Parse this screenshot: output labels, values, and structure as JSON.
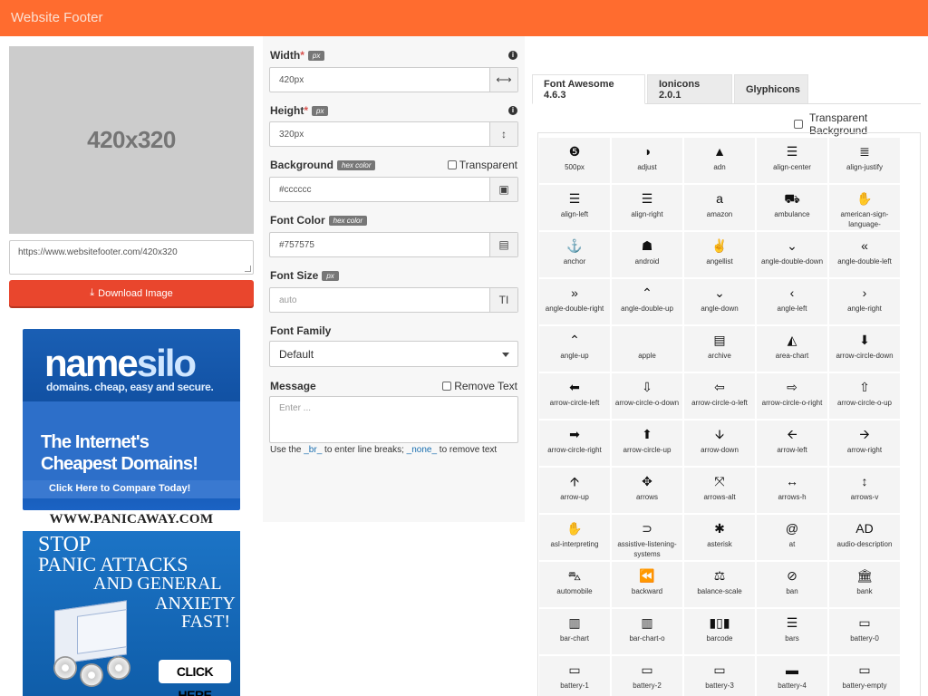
{
  "header": {
    "title": "Website Footer"
  },
  "preview": {
    "text": "420x320",
    "url": "https://www.websitefooter.com/420x320",
    "download_label": "Download Image"
  },
  "form": {
    "width": {
      "label": "Width",
      "unit": "px",
      "value": "420px"
    },
    "height": {
      "label": "Height",
      "unit": "px",
      "value": "320px"
    },
    "background": {
      "label": "Background",
      "unit": "hex color",
      "value": "#cccccc",
      "transparent_label": "Transparent"
    },
    "font_color": {
      "label": "Font Color",
      "unit": "hex color",
      "value": "#757575"
    },
    "font_size": {
      "label": "Font Size",
      "unit": "px",
      "placeholder": "auto"
    },
    "font_family": {
      "label": "Font Family",
      "selected": "Default"
    },
    "message": {
      "label": "Message",
      "remove_label": "Remove Text",
      "placeholder": "Enter ..."
    },
    "hint": {
      "pre": "Use the ",
      "br": "_br_",
      "mid": " to enter line breaks; ",
      "none": "_none_",
      "post": " to remove text"
    }
  },
  "ads": {
    "namesilo": {
      "logo_a": "name",
      "logo_b": "silo",
      "tagline": "domains. cheap, easy and secure.",
      "headline1": "The Internet's",
      "headline2": "Cheapest Domains!",
      "cta": "Click Here to Compare Today!"
    },
    "panic": {
      "url": "WWW.PANICAWAY.COM",
      "line1": "STOP",
      "line2": "PANIC ATTACKS",
      "line3": "AND GENERAL",
      "line4": "ANXIETY",
      "line5": "FAST!",
      "cta": "CLICK HERE"
    }
  },
  "tabs": [
    "Font Awesome 4.6.3",
    "Ionicons 2.0.1",
    "Glyphicons"
  ],
  "transparent_background_label": "Transparent Background",
  "icons": [
    {
      "g": "❺",
      "n": "500px"
    },
    {
      "g": "◑",
      "n": "adjust"
    },
    {
      "g": "▲",
      "n": "adn"
    },
    {
      "g": "☰",
      "n": "align-center"
    },
    {
      "g": "≣",
      "n": "align-justify"
    },
    {
      "g": "☰",
      "n": "align-left"
    },
    {
      "g": "☰",
      "n": "align-right"
    },
    {
      "g": "a",
      "n": "amazon"
    },
    {
      "g": "⛟",
      "n": "ambulance"
    },
    {
      "g": "✋",
      "n": "american-sign-language-interpreting"
    },
    {
      "g": "⚓",
      "n": "anchor"
    },
    {
      "g": "☗",
      "n": "android"
    },
    {
      "g": "✌",
      "n": "angellist"
    },
    {
      "g": "⌄",
      "n": "angle-double-down"
    },
    {
      "g": "«",
      "n": "angle-double-left"
    },
    {
      "g": "»",
      "n": "angle-double-right"
    },
    {
      "g": "⌃",
      "n": "angle-double-up"
    },
    {
      "g": "⌄",
      "n": "angle-down"
    },
    {
      "g": "‹",
      "n": "angle-left"
    },
    {
      "g": "›",
      "n": "angle-right"
    },
    {
      "g": "⌃",
      "n": "angle-up"
    },
    {
      "g": "",
      "n": "apple"
    },
    {
      "g": "▤",
      "n": "archive"
    },
    {
      "g": "◭",
      "n": "area-chart"
    },
    {
      "g": "⬇",
      "n": "arrow-circle-down"
    },
    {
      "g": "⬅",
      "n": "arrow-circle-left"
    },
    {
      "g": "⇩",
      "n": "arrow-circle-o-down"
    },
    {
      "g": "⇦",
      "n": "arrow-circle-o-left"
    },
    {
      "g": "⇨",
      "n": "arrow-circle-o-right"
    },
    {
      "g": "⇧",
      "n": "arrow-circle-o-up"
    },
    {
      "g": "➡",
      "n": "arrow-circle-right"
    },
    {
      "g": "⬆",
      "n": "arrow-circle-up"
    },
    {
      "g": "🡫",
      "n": "arrow-down"
    },
    {
      "g": "🡨",
      "n": "arrow-left"
    },
    {
      "g": "🡪",
      "n": "arrow-right"
    },
    {
      "g": "🡩",
      "n": "arrow-up"
    },
    {
      "g": "✥",
      "n": "arrows"
    },
    {
      "g": "⤧",
      "n": "arrows-alt"
    },
    {
      "g": "↔",
      "n": "arrows-h"
    },
    {
      "g": "↕",
      "n": "arrows-v"
    },
    {
      "g": "✋",
      "n": "asl-interpreting"
    },
    {
      "g": "⊃",
      "n": "assistive-listening-systems"
    },
    {
      "g": "✱",
      "n": "asterisk"
    },
    {
      "g": "@",
      "n": "at"
    },
    {
      "g": "AD",
      "n": "audio-description"
    },
    {
      "g": "⛍",
      "n": "automobile"
    },
    {
      "g": "⏪",
      "n": "backward"
    },
    {
      "g": "⚖",
      "n": "balance-scale"
    },
    {
      "g": "⊘",
      "n": "ban"
    },
    {
      "g": "🏛",
      "n": "bank"
    },
    {
      "g": "▥",
      "n": "bar-chart"
    },
    {
      "g": "▥",
      "n": "bar-chart-o"
    },
    {
      "g": "▮▯▮",
      "n": "barcode"
    },
    {
      "g": "☰",
      "n": "bars"
    },
    {
      "g": "▭",
      "n": "battery-0"
    },
    {
      "g": "▭",
      "n": "battery-1"
    },
    {
      "g": "▭",
      "n": "battery-2"
    },
    {
      "g": "▭",
      "n": "battery-3"
    },
    {
      "g": "▬",
      "n": "battery-4"
    },
    {
      "g": "▭",
      "n": "battery-empty"
    }
  ]
}
